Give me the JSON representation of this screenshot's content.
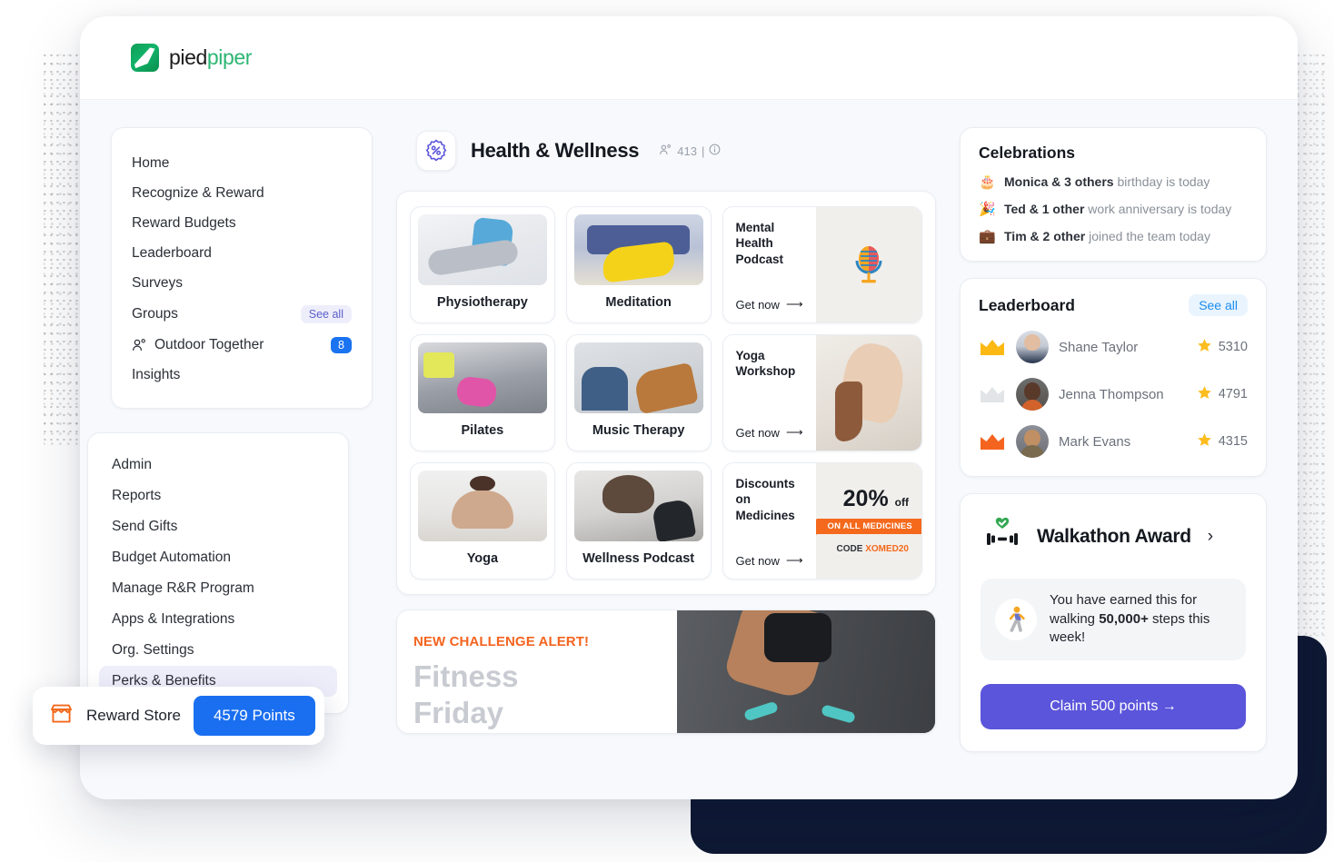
{
  "brand": {
    "name_part1": "pied",
    "name_part2": "piper",
    "logo_icon": "piedpiper-leaf-logo"
  },
  "sidebar": {
    "items": [
      {
        "label": "Home"
      },
      {
        "label": "Recognize & Reward"
      },
      {
        "label": "Reward Budgets"
      },
      {
        "label": "Leaderboard"
      },
      {
        "label": "Surveys"
      },
      {
        "label": "Groups",
        "action": "See all"
      },
      {
        "label": "Outdoor Together",
        "badge": "8",
        "icon": "people-icon"
      },
      {
        "label": "Insights"
      }
    ]
  },
  "admin_menu": {
    "items": [
      {
        "label": "Admin"
      },
      {
        "label": "Reports"
      },
      {
        "label": "Send Gifts"
      },
      {
        "label": "Budget Automation"
      },
      {
        "label": "Manage R&R Program"
      },
      {
        "label": "Apps & Integrations"
      },
      {
        "label": "Org. Settings"
      },
      {
        "label": "Perks & Benefits",
        "active": true
      }
    ]
  },
  "main": {
    "title": "Health & Wellness",
    "badge_icon": "percent-badge-icon",
    "member_count": "413",
    "member_icon": "people-icon",
    "info_icon": "info-icon",
    "tiles": [
      {
        "label": "Physiotherapy",
        "image": "physiotherapy-photo"
      },
      {
        "label": "Meditation",
        "image": "meditation-photo"
      },
      {
        "label": "Pilates",
        "image": "pilates-photo"
      },
      {
        "label": "Music Therapy",
        "image": "music-therapy-photo"
      },
      {
        "label": "Yoga",
        "image": "yoga-photo"
      },
      {
        "label": "Wellness Podcast",
        "image": "wellness-podcast-photo"
      }
    ],
    "promos": [
      {
        "title": "Mental Health Podcast",
        "cta": "Get now",
        "image": "microphone-brain-illustration"
      },
      {
        "title": "Yoga Workshop",
        "cta": "Get now",
        "image": "yoga-pose-photo"
      },
      {
        "title": "Discounts on Medicines",
        "cta": "Get now",
        "discount": "20%",
        "discount_suffix": "off",
        "tag": "ON ALL MEDICINES",
        "code_label": "CODE",
        "code_value": "XOMED20"
      }
    ],
    "challenge": {
      "alert": "NEW CHALLENGE ALERT!",
      "line1": "Fitness",
      "line2": "Friday",
      "image": "runner-photo"
    }
  },
  "celebrations": {
    "title": "Celebrations",
    "items": [
      {
        "emoji": "🎂",
        "icon": "birthday-cake-icon",
        "bold": "Monica & 3 others",
        "rest": " birthday is today"
      },
      {
        "emoji": "🎉",
        "icon": "party-popper-icon",
        "bold": "Ted & 1 other",
        "rest": " work anniversary is today"
      },
      {
        "emoji": "💼",
        "icon": "briefcase-icon",
        "bold": "Tim & 2 other",
        "rest": " joined the team today"
      }
    ]
  },
  "leaderboard": {
    "title": "Leaderboard",
    "see_all": "See all",
    "rows": [
      {
        "name": "Shane Taylor",
        "score": "5310",
        "crown": "#FDB913",
        "star": "#FDBD1E"
      },
      {
        "name": "Jenna Thompson",
        "score": "4791",
        "crown": "#E2E5E8",
        "star": "#FDBD1E"
      },
      {
        "name": "Mark Evans",
        "score": "4315",
        "crown": "#F4641F",
        "star": "#FDBD1E"
      }
    ]
  },
  "walkathon": {
    "title": "Walkathon Award",
    "icon": "dumbbell-heart-icon",
    "chevron": "›",
    "note_icon": "walking-person-icon",
    "note_pre": "You have earned this for walking ",
    "note_bold": "50,000+",
    "note_post": " steps this week!",
    "claim_label": "Claim 500 points →"
  },
  "reward_store": {
    "icon": "store-icon",
    "label": "Reward Store",
    "points": "4579 Points"
  },
  "colors": {
    "accent_purple": "#5B55DB",
    "accent_blue": "#1A6FF0",
    "accent_orange": "#F4641F",
    "brand_green": "#2BB673"
  }
}
